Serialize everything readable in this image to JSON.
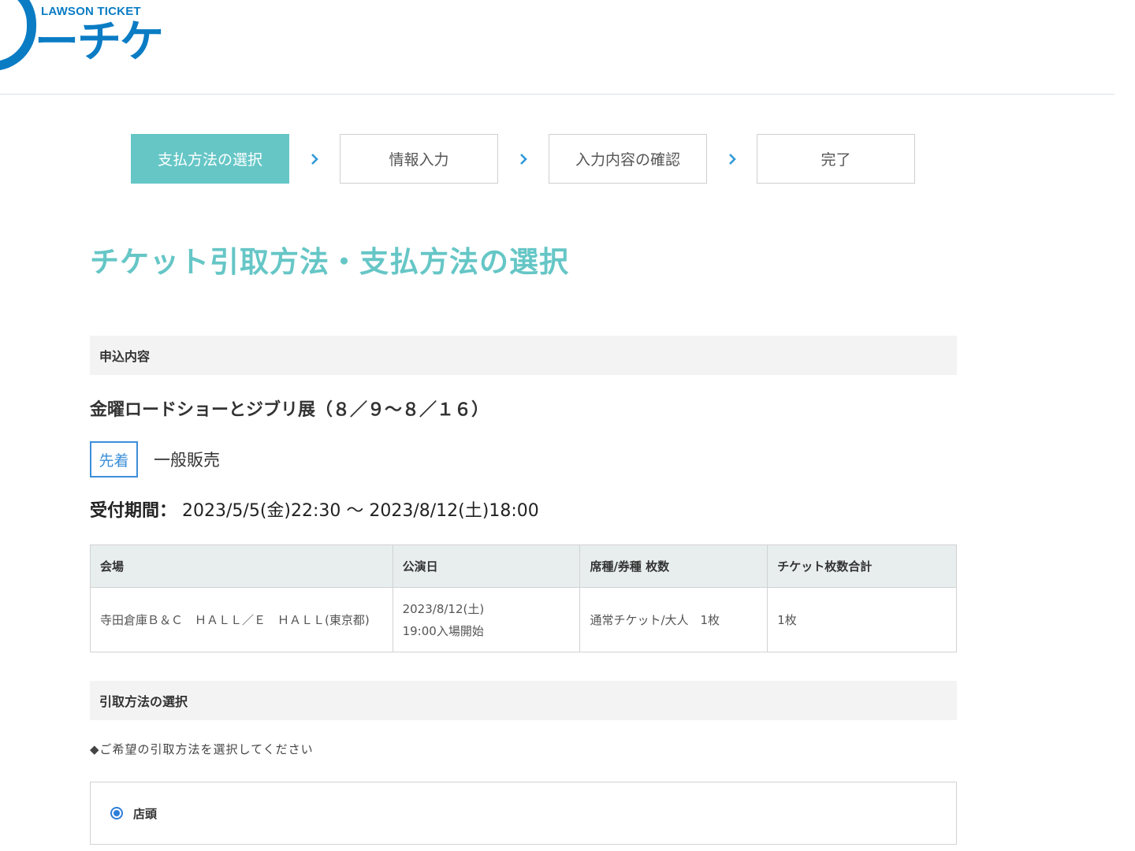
{
  "brand": {
    "logo_sub": "LAWSON TICKET",
    "logo_main": "ーチケ",
    "accent": "#66c6c6",
    "logo_color": "#0a7cc4"
  },
  "steps": [
    {
      "label": "支払方法の選択",
      "active": true
    },
    {
      "label": "情報入力",
      "active": false
    },
    {
      "label": "入力内容の確認",
      "active": false
    },
    {
      "label": "完了",
      "active": false
    }
  ],
  "page_title": "チケット引取方法・支払方法の選択",
  "application": {
    "section_title": "申込内容",
    "event_title": "金曜ロードショーとジブリ展（８／９～８／１６）",
    "badge": "先着",
    "sale_type": "一般販売",
    "period_label": "受付期間：",
    "period_value": "2023/5/5(金)22:30 ～ 2023/8/12(土)18:00",
    "table": {
      "headers": [
        "会場",
        "公演日",
        "席種/券種 枚数",
        "チケット枚数合計"
      ],
      "row": {
        "venue": "寺田倉庫Ｂ＆Ｃ　ＨＡＬＬ／Ｅ　ＨＡＬＬ(東京都)",
        "date": "2023/8/12(土)\n19:00入場開始",
        "seat": "通常チケット/大人　1枚",
        "total": "1枚"
      }
    }
  },
  "pickup": {
    "section_title": "引取方法の選択",
    "instruction": "◆ご希望の引取方法を選択してください",
    "options": [
      {
        "label": "店頭",
        "selected": true
      }
    ]
  }
}
